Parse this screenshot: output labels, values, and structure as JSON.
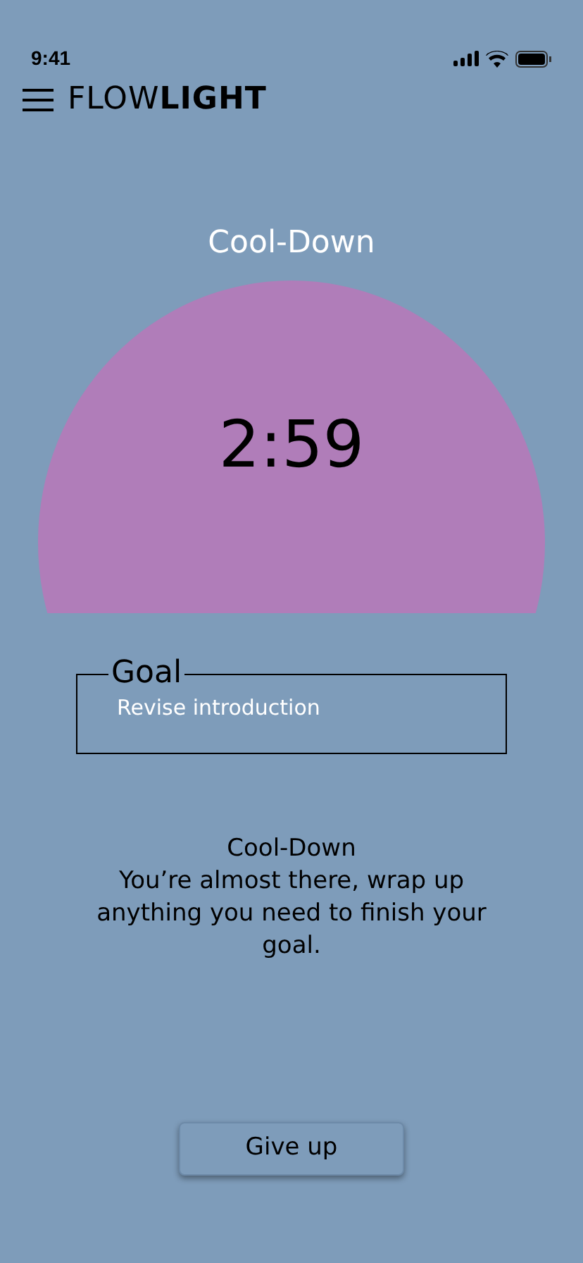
{
  "status_bar": {
    "time": "9:41"
  },
  "header": {
    "logo": "FLOW**LIGHT**"
  },
  "phase": {
    "title": "Cool-Down",
    "timer": "2:59"
  },
  "goal": {
    "legend": "Goal",
    "text": "Revise introduction"
  },
  "message": {
    "title": "Cool-Down",
    "body": "You’re almost there, wrap up anything you need to finish your goal."
  },
  "buttons": [
    "Give up"
  ]
}
